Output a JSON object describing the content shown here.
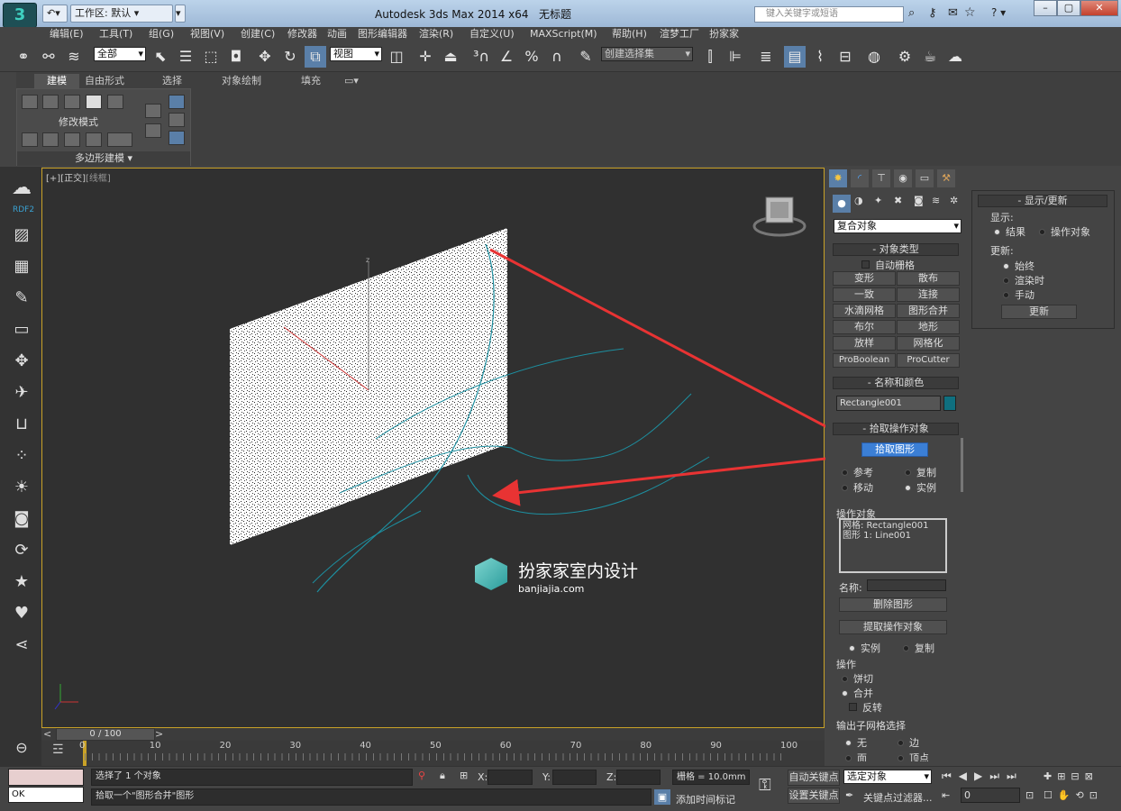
{
  "titlebar": {
    "app_title": "Autodesk 3ds Max  2014 x64",
    "doc_title": "无标题",
    "workspace_label": "工作区: 默认",
    "search_placeholder": "键入关键字或短语"
  },
  "menubar": [
    "编辑(E)",
    "工具(T)",
    "组(G)",
    "视图(V)",
    "创建(C)",
    "修改器",
    "动画",
    "图形编辑器",
    "渲染(R)",
    "自定义(U)",
    "MAXScript(M)",
    "帮助(H)",
    "渲梦工厂",
    "扮家家"
  ],
  "toolbar": {
    "filter": "全部",
    "refcoord": "视图",
    "selset": "创建选择集"
  },
  "ribbon": {
    "tabs": [
      "建模",
      "自由形式",
      "选择",
      "对象绘制",
      "填充"
    ],
    "group_label": "修改模式",
    "footer": "多边形建模"
  },
  "viewport": {
    "label_plus": "[+]",
    "label_view": "[正交]",
    "label_shade": "[线框]",
    "watermark_title": "扮家家室内设计",
    "watermark_url": "banjiajia.com",
    "axis_z": "z"
  },
  "leftbar": {
    "rdf": "RDF2"
  },
  "command_panel": {
    "category": "复合对象",
    "object_type": {
      "header": "对象类型",
      "autogrid": "自动栅格",
      "buttons": [
        "变形",
        "散布",
        "一致",
        "连接",
        "水滴网格",
        "图形合并",
        "布尔",
        "地形",
        "放样",
        "网格化",
        "ProBoolean",
        "ProCutter"
      ]
    },
    "name_color": {
      "header": "名称和颜色",
      "name": "Rectangle001",
      "color": "#0f6f7f"
    },
    "pick": {
      "header": "拾取操作对象",
      "button": "拾取图形",
      "r_ref": "参考",
      "r_copy": "复制",
      "r_move": "移动",
      "r_inst": "实例"
    },
    "operands": {
      "header": "操作对象",
      "list": [
        "网格: Rectangle001",
        "图形 1: Line001"
      ],
      "name_label": "名称:",
      "delete_btn": "删除图形",
      "extract_btn": "提取操作对象",
      "r_inst": "实例",
      "r_copy": "复制"
    },
    "ops": {
      "header": "操作",
      "cookie": "饼切",
      "merge": "合并",
      "invert": "反转"
    },
    "output": {
      "header": "输出子网格选择",
      "none": "无",
      "edge": "边",
      "face": "面",
      "vertex": "顶点"
    }
  },
  "display_panel": {
    "header": "显示/更新",
    "display_label": "显示:",
    "result": "结果",
    "operands": "操作对象",
    "update_label": "更新:",
    "always": "始终",
    "when_render": "渲染时",
    "manual": "手动",
    "update_btn": "更新"
  },
  "timeline": {
    "frame": "0 / 100",
    "ticks": [
      "0",
      "10",
      "20",
      "30",
      "40",
      "50",
      "60",
      "70",
      "80",
      "90",
      "100"
    ]
  },
  "status": {
    "line1": "选择了 1 个对象",
    "line2": "拾取一个\"图形合并\"图形",
    "ok": "OK",
    "x": "X:",
    "y": "Y:",
    "z": "Z:",
    "grid": "栅格 = 10.0mm",
    "add_tag": "添加时间标记",
    "autokey": "自动关键点",
    "setkey": "设置关键点",
    "selected": "选定对象",
    "keyfilter": "关键点过滤器...",
    "frame_field": "0"
  }
}
